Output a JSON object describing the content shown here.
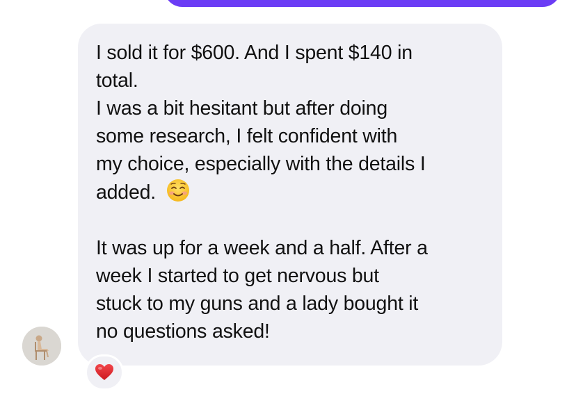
{
  "conversation": {
    "sent_bubble_color": "#6b3cf5",
    "received_bubble_color": "#f0f0f5",
    "received_message": {
      "paragraph_1_line_1": "I sold it for $600. And I spent $140 in",
      "paragraph_1_line_2": "total.",
      "paragraph_2_line_1": "I was a bit hesitant but after doing",
      "paragraph_2_line_2": "some research, I felt confident with",
      "paragraph_2_line_3": "my choice, especially with the details I",
      "paragraph_2_line_4": "added.",
      "paragraph_2_emoji": "smiling-face-icon",
      "paragraph_3_line_1": "It was up for a week and a half. After a",
      "paragraph_3_line_2": "week I started to get nervous but",
      "paragraph_3_line_3": "stuck to my guns and a lady bought it",
      "paragraph_3_line_4": "no questions asked!"
    },
    "reaction": {
      "icon": "red-heart-icon",
      "color": "#e0242a"
    },
    "sender_avatar": {
      "icon": "figure-on-chair-avatar"
    }
  }
}
